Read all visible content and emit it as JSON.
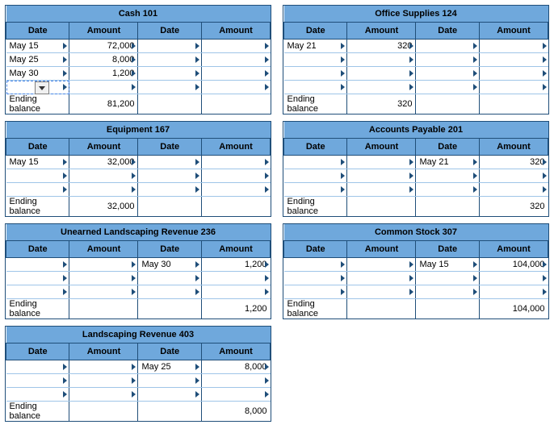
{
  "headers": {
    "date": "Date",
    "amount": "Amount"
  },
  "ending_label": "Ending balance",
  "accounts": {
    "cash": {
      "title": "Cash 101",
      "left": [
        {
          "date": "May 15",
          "amount": "72,000"
        },
        {
          "date": "May 25",
          "amount": "8,000"
        },
        {
          "date": "May 30",
          "amount": "1,200"
        },
        {
          "date": "",
          "amount": ""
        }
      ],
      "right": [
        {
          "date": "",
          "amount": ""
        },
        {
          "date": "",
          "amount": ""
        },
        {
          "date": "",
          "amount": ""
        },
        {
          "date": "",
          "amount": ""
        }
      ],
      "bal_left": "81,200",
      "bal_right": ""
    },
    "supplies": {
      "title": "Office Supplies 124",
      "left": [
        {
          "date": "May 21",
          "amount": "320"
        },
        {
          "date": "",
          "amount": ""
        },
        {
          "date": "",
          "amount": ""
        },
        {
          "date": "",
          "amount": ""
        }
      ],
      "right": [
        {
          "date": "",
          "amount": ""
        },
        {
          "date": "",
          "amount": ""
        },
        {
          "date": "",
          "amount": ""
        },
        {
          "date": "",
          "amount": ""
        }
      ],
      "bal_left": "320",
      "bal_right": ""
    },
    "equip": {
      "title": "Equipment 167",
      "left": [
        {
          "date": "May 15",
          "amount": "32,000"
        },
        {
          "date": "",
          "amount": ""
        },
        {
          "date": "",
          "amount": ""
        }
      ],
      "right": [
        {
          "date": "",
          "amount": ""
        },
        {
          "date": "",
          "amount": ""
        },
        {
          "date": "",
          "amount": ""
        }
      ],
      "bal_left": "32,000",
      "bal_right": ""
    },
    "ap": {
      "title": "Accounts Payable 201",
      "left": [
        {
          "date": "",
          "amount": ""
        },
        {
          "date": "",
          "amount": ""
        },
        {
          "date": "",
          "amount": ""
        }
      ],
      "right": [
        {
          "date": "May 21",
          "amount": "320"
        },
        {
          "date": "",
          "amount": ""
        },
        {
          "date": "",
          "amount": ""
        }
      ],
      "bal_left": "",
      "bal_right": "320"
    },
    "unrev": {
      "title": "Unearned Landscaping Revenue 236",
      "left": [
        {
          "date": "",
          "amount": ""
        },
        {
          "date": "",
          "amount": ""
        },
        {
          "date": "",
          "amount": ""
        }
      ],
      "right": [
        {
          "date": "May 30",
          "amount": "1,200"
        },
        {
          "date": "",
          "amount": ""
        },
        {
          "date": "",
          "amount": ""
        }
      ],
      "bal_left": "",
      "bal_right": "1,200"
    },
    "cstock": {
      "title": "Common Stock 307",
      "left": [
        {
          "date": "",
          "amount": ""
        },
        {
          "date": "",
          "amount": ""
        },
        {
          "date": "",
          "amount": ""
        }
      ],
      "right": [
        {
          "date": "May 15",
          "amount": "104,000"
        },
        {
          "date": "",
          "amount": ""
        },
        {
          "date": "",
          "amount": ""
        }
      ],
      "bal_left": "",
      "bal_right": "104,000"
    },
    "lrev": {
      "title": "Landscaping Revenue 403",
      "left": [
        {
          "date": "",
          "amount": ""
        },
        {
          "date": "",
          "amount": ""
        },
        {
          "date": "",
          "amount": ""
        }
      ],
      "right": [
        {
          "date": "May 25",
          "amount": "8,000"
        },
        {
          "date": "",
          "amount": ""
        },
        {
          "date": "",
          "amount": ""
        }
      ],
      "bal_left": "",
      "bal_right": "8,000"
    }
  },
  "chart_data": [
    {
      "type": "table",
      "title": "Cash 101",
      "debits": [
        [
          "May 15",
          72000
        ],
        [
          "May 25",
          8000
        ],
        [
          "May 30",
          1200
        ]
      ],
      "credits": [],
      "ending_debit": 81200,
      "ending_credit": null
    },
    {
      "type": "table",
      "title": "Office Supplies 124",
      "debits": [
        [
          "May 21",
          320
        ]
      ],
      "credits": [],
      "ending_debit": 320,
      "ending_credit": null
    },
    {
      "type": "table",
      "title": "Equipment 167",
      "debits": [
        [
          "May 15",
          32000
        ]
      ],
      "credits": [],
      "ending_debit": 32000,
      "ending_credit": null
    },
    {
      "type": "table",
      "title": "Accounts Payable 201",
      "debits": [],
      "credits": [
        [
          "May 21",
          320
        ]
      ],
      "ending_debit": null,
      "ending_credit": 320
    },
    {
      "type": "table",
      "title": "Unearned Landscaping Revenue 236",
      "debits": [],
      "credits": [
        [
          "May 30",
          1200
        ]
      ],
      "ending_debit": null,
      "ending_credit": 1200
    },
    {
      "type": "table",
      "title": "Common Stock 307",
      "debits": [],
      "credits": [
        [
          "May 15",
          104000
        ]
      ],
      "ending_debit": null,
      "ending_credit": 104000
    },
    {
      "type": "table",
      "title": "Landscaping Revenue 403",
      "debits": [],
      "credits": [
        [
          "May 25",
          8000
        ]
      ],
      "ending_debit": null,
      "ending_credit": 8000
    }
  ]
}
